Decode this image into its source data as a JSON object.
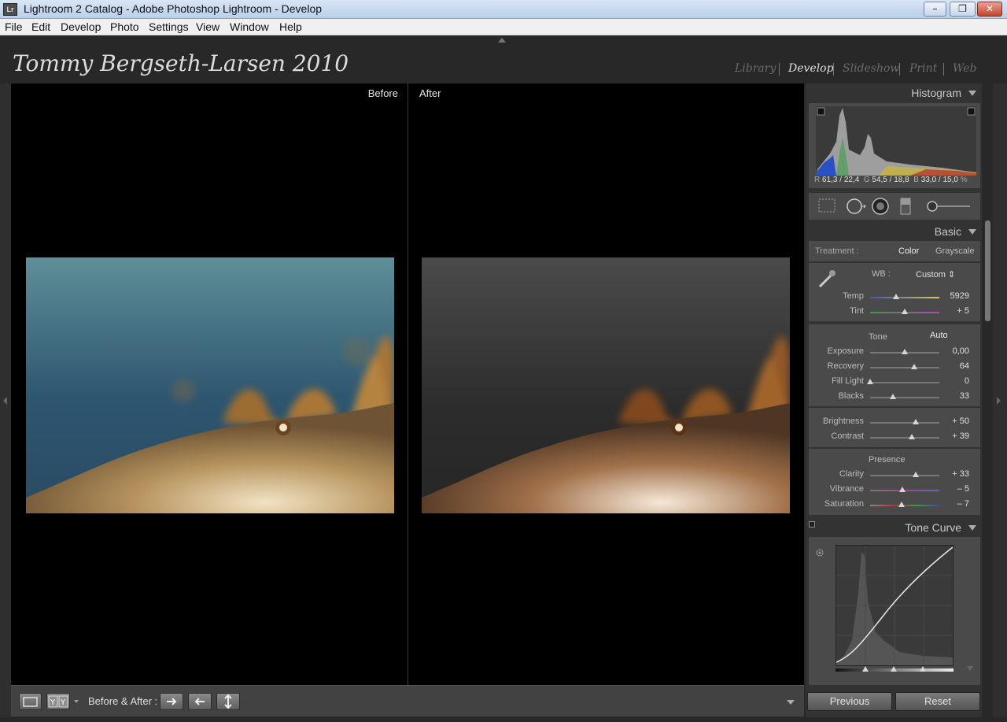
{
  "window": {
    "app_icon": "Lr",
    "title": "Lightroom 2 Catalog - Adobe Photoshop Lightroom - Develop",
    "controls": {
      "minimize": "–",
      "maximize": "❐",
      "close": "✕"
    }
  },
  "menubar": [
    "File",
    "Edit",
    "Develop",
    "Photo",
    "Settings",
    "View",
    "Window",
    "Help"
  ],
  "identity_plate": "Tommy Bergseth-Larsen 2010",
  "modules": [
    "Library",
    "Develop",
    "Slideshow",
    "Print",
    "Web"
  ],
  "active_module": "Develop",
  "viewport": {
    "before_label": "Before",
    "after_label": "After"
  },
  "toolbar": {
    "before_after_label": "Before & After :"
  },
  "panels": {
    "histogram": {
      "title": "Histogram",
      "readout": {
        "r_label": "R",
        "r": "61,3 / 22,4",
        "g_label": "G",
        "g": "54,5 / 18,8",
        "b_label": "B",
        "b": "33,0 / 15,0",
        "unit": "%"
      }
    },
    "basic": {
      "title": "Basic",
      "treatment_label": "Treatment :",
      "treatment_color": "Color",
      "treatment_grayscale": "Grayscale",
      "wb_label": "WB :",
      "wb_value": "Custom ⇕",
      "sliders_wb": [
        {
          "label": "Temp",
          "value": "5929",
          "pos": 0.38
        },
        {
          "label": "Tint",
          "value": "+ 5",
          "pos": 0.5
        }
      ],
      "tone_label": "Tone",
      "auto_label": "Auto",
      "sliders_tone": [
        {
          "label": "Exposure",
          "value": "0,00",
          "pos": 0.5
        },
        {
          "label": "Recovery",
          "value": "64",
          "pos": 0.64
        },
        {
          "label": "Fill Light",
          "value": "0",
          "pos": 0.0
        },
        {
          "label": "Blacks",
          "value": "33",
          "pos": 0.33
        }
      ],
      "sliders_bc": [
        {
          "label": "Brightness",
          "value": "+ 50",
          "pos": 0.66
        },
        {
          "label": "Contrast",
          "value": "+ 39",
          "pos": 0.6
        }
      ],
      "presence_label": "Presence",
      "sliders_presence": [
        {
          "label": "Clarity",
          "value": "+ 33",
          "pos": 0.66
        },
        {
          "label": "Vibrance",
          "value": "– 5",
          "pos": 0.47
        },
        {
          "label": "Saturation",
          "value": "– 7",
          "pos": 0.46
        }
      ]
    },
    "tone_curve": {
      "title": "Tone Curve"
    }
  },
  "buttons": {
    "previous": "Previous",
    "reset": "Reset"
  }
}
